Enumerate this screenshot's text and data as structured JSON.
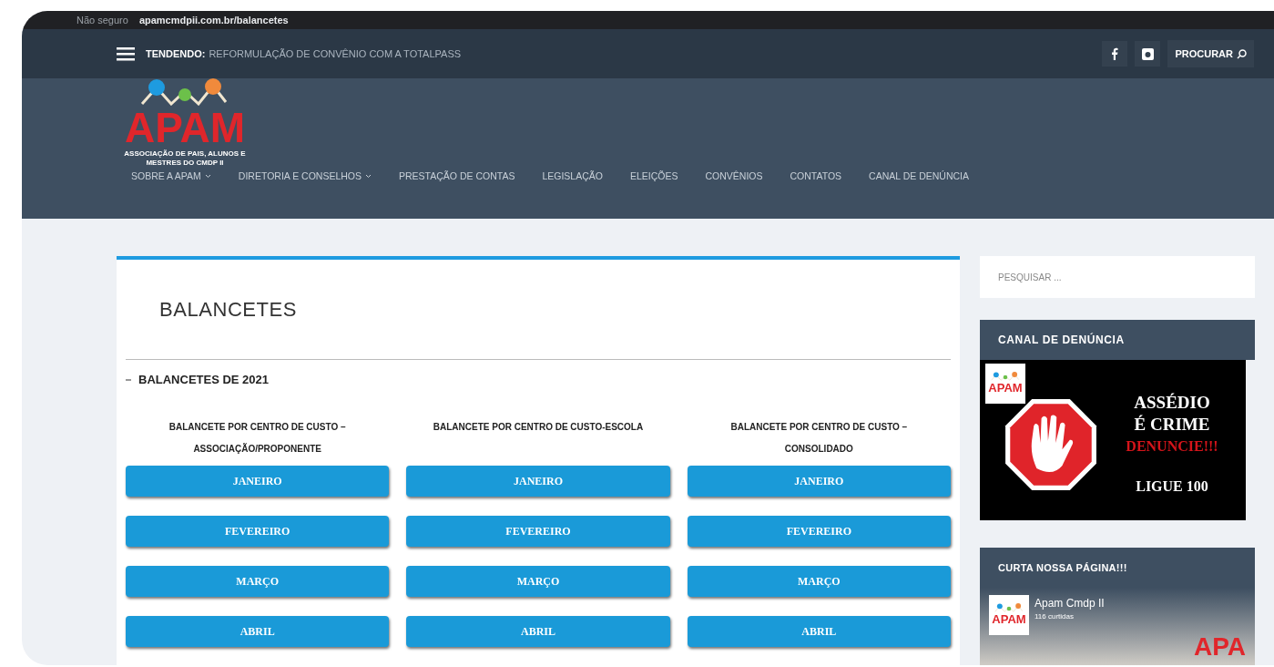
{
  "browser": {
    "security": "Não seguro",
    "url": "apamcmdpii.com.br/balancetes"
  },
  "top_bar": {
    "trending_label": "TENDENDO:",
    "trending_text": "REFORMULAÇÃO DE CONVÊNIO COM A TOTALPASS",
    "search_button": "PROCURAR"
  },
  "logo": {
    "text": "APAM",
    "subtitle": "ASSOCIAÇÃO DE PAIS, ALUNOS E MESTRES DO CMDP II"
  },
  "nav": [
    {
      "label": "SOBRE A APAM",
      "has_dropdown": true
    },
    {
      "label": "DIRETORIA E CONSELHOS",
      "has_dropdown": true
    },
    {
      "label": "PRESTAÇÃO DE CONTAS",
      "has_dropdown": false
    },
    {
      "label": "LEGISLAÇÃO",
      "has_dropdown": false
    },
    {
      "label": "ELEIÇÕES",
      "has_dropdown": false
    },
    {
      "label": "CONVÊNIOS",
      "has_dropdown": false
    },
    {
      "label": "CONTATOS",
      "has_dropdown": false
    },
    {
      "label": "CANAL DE DENÚNCIA",
      "has_dropdown": false
    }
  ],
  "content": {
    "title": "BALANCETES",
    "section": {
      "label": "BALANCETES DE 2021",
      "expanded": true
    },
    "columns": [
      {
        "heading": "BALANCETE POR CENTRO DE CUSTO – ASSOCIAÇÃO/PROPONENTE",
        "months": [
          "JANEIRO",
          "FEVEREIRO",
          "MARÇO",
          "ABRIL"
        ]
      },
      {
        "heading": "BALANCETE POR CENTRO DE CUSTO-ESCOLA",
        "months": [
          "JANEIRO",
          "FEVEREIRO",
          "MARÇO",
          "ABRIL"
        ]
      },
      {
        "heading": "BALANCETE POR CENTRO DE CUSTO – CONSOLIDADO",
        "months": [
          "JANEIRO",
          "FEVEREIRO",
          "MARÇO",
          "ABRIL"
        ]
      }
    ]
  },
  "sidebar": {
    "search": {
      "placeholder": "PESQUISAR ..."
    },
    "report_widget": {
      "title": "CANAL DE DENÚNCIA",
      "banner_logo_text": "APAM",
      "banner_lines": [
        "ASSÉDIO",
        "É CRIME",
        "DENUNCIE!!!",
        "LIGUE 100"
      ]
    },
    "facebook_widget": {
      "title": "CURTA NOSSA PÁGINA!!!",
      "avatar_text": "APAM",
      "page_name": "Apam Cmdp II",
      "likes": "116 curtidas",
      "cover_text": "APA"
    }
  }
}
